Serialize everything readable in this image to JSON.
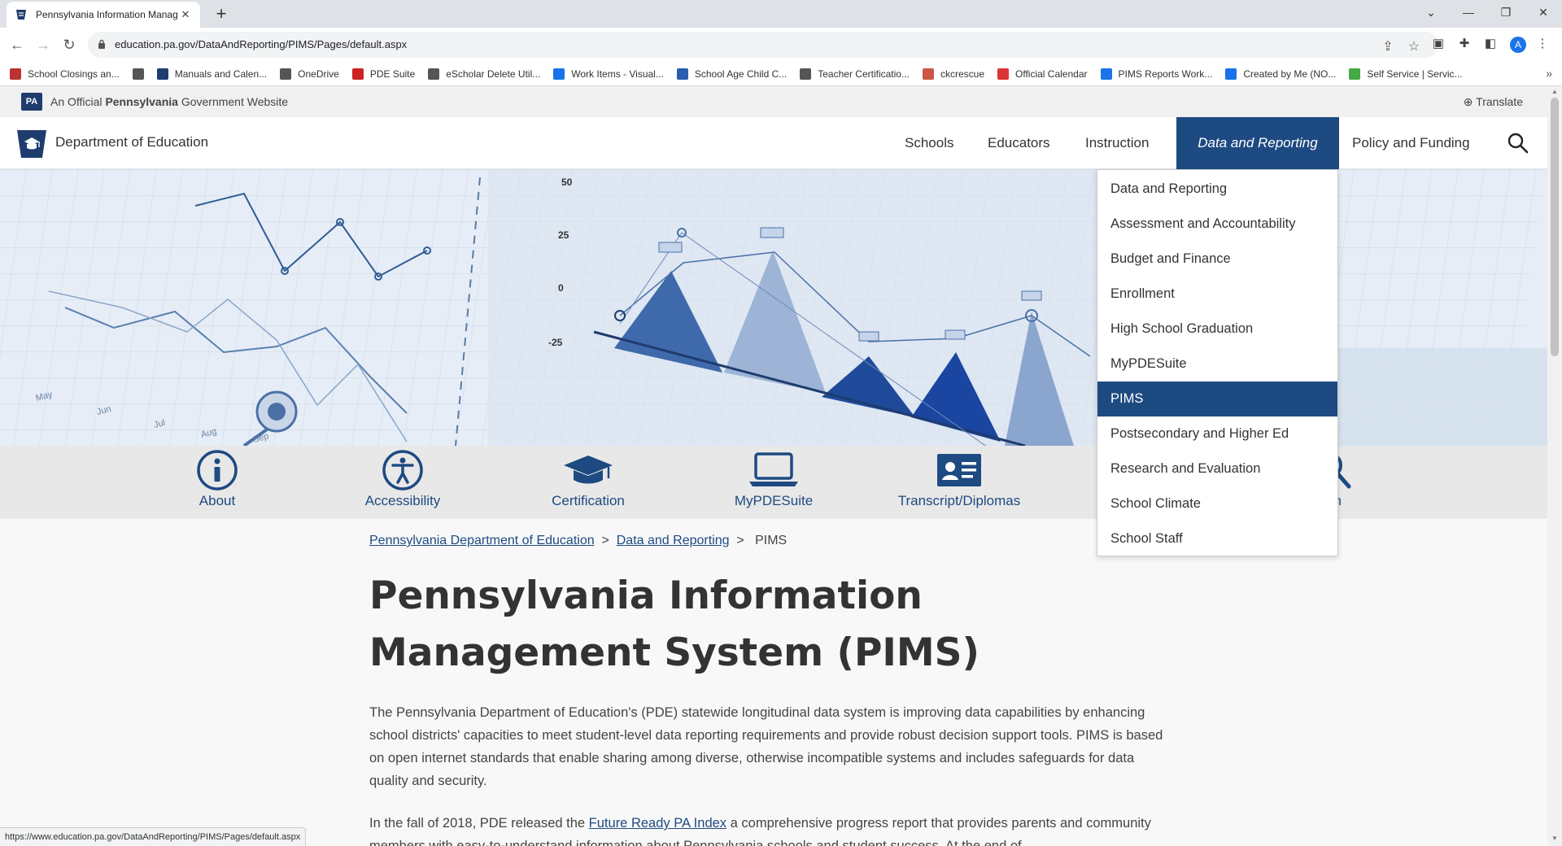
{
  "browser": {
    "tab_title": "Pennsylvania Information Manag",
    "url": "education.pa.gov/DataAndReporting/PIMS/Pages/default.aspx",
    "bookmarks": [
      {
        "label": "School Closings an...",
        "color": "#b33"
      },
      {
        "label": "",
        "color": "#555"
      },
      {
        "label": "Manuals and Calen...",
        "color": "#1e3c6e"
      },
      {
        "label": "OneDrive",
        "color": "#555"
      },
      {
        "label": "PDE Suite",
        "color": "#c22"
      },
      {
        "label": "eScholar Delete Util...",
        "color": "#555"
      },
      {
        "label": "Work Items - Visual...",
        "color": "#1a73e8"
      },
      {
        "label": "School Age Child C...",
        "color": "#2a5db0"
      },
      {
        "label": "Teacher Certificatio...",
        "color": "#555"
      },
      {
        "label": "ckcrescue",
        "color": "#c54"
      },
      {
        "label": "Official Calendar",
        "color": "#d33"
      },
      {
        "label": "PIMS Reports Work...",
        "color": "#1a73e8"
      },
      {
        "label": "Created by Me (NO...",
        "color": "#1a73e8"
      },
      {
        "label": "Self Service | Servic...",
        "color": "#4a4"
      }
    ],
    "avatar_letter": "A",
    "status_url": "https://www.education.pa.gov/DataAndReporting/PIMS/Pages/default.aspx"
  },
  "site": {
    "gov_banner_prefix": "An Official",
    "gov_banner_state": "Pennsylvania",
    "gov_banner_suffix": "Government Website",
    "pa_badge": "PA",
    "translate": "Translate",
    "department": "Department of Education",
    "nav": [
      "Schools",
      "Educators",
      "Instruction",
      "Data and Reporting",
      "Policy and Funding"
    ],
    "active_nav": "Data and Reporting"
  },
  "hero_chart": {
    "y_ticks": [
      "50",
      "25",
      "0",
      "-25"
    ],
    "x_ticks": [
      "May",
      "Jun",
      "Jul",
      "Aug",
      "Sep"
    ]
  },
  "quicklinks": [
    "About",
    "Accessibility",
    "Certification",
    "MyPDESuite",
    "Transcript/Diplomas",
    "ch"
  ],
  "dropdown": {
    "items": [
      "Data and Reporting",
      "Assessment and Accountability",
      "Budget and Finance",
      "Enrollment",
      "High School Graduation",
      "MyPDESuite",
      "PIMS",
      "Postsecondary and Higher Ed",
      "Research and Evaluation",
      "School Climate",
      "School Staff"
    ],
    "active": "PIMS"
  },
  "breadcrumb": {
    "home": "Pennsylvania Department of Education",
    "parent": "Data and Reporting",
    "current": "PIMS"
  },
  "page": {
    "title": "Pennsylvania Information Management System (PIMS)",
    "para1": "The Pennsylvania Department of Education's (PDE) statewide longitudinal data system is improving data capabilities by enhancing school districts' capacities to meet student-level data reporting requirements and provide robust decision support tools. PIMS is based on open internet standards that enable sharing among diverse, otherwise incompatible systems and includes safeguards for data quality and security.",
    "para2_before": "In the fall of 2018, PDE released the ",
    "para2_link": "Future Ready PA Index",
    "para2_after": " a comprehensive progress report that provides parents and community members with easy-to-understand information about Pennsylvania schools and student success. At the end of"
  }
}
